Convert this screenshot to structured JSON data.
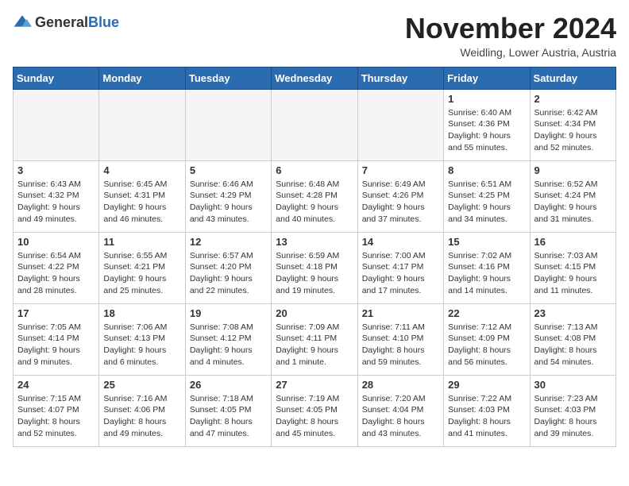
{
  "header": {
    "logo_general": "General",
    "logo_blue": "Blue",
    "month_title": "November 2024",
    "location": "Weidling, Lower Austria, Austria"
  },
  "weekdays": [
    "Sunday",
    "Monday",
    "Tuesday",
    "Wednesday",
    "Thursday",
    "Friday",
    "Saturday"
  ],
  "weeks": [
    [
      {
        "day": "",
        "info": ""
      },
      {
        "day": "",
        "info": ""
      },
      {
        "day": "",
        "info": ""
      },
      {
        "day": "",
        "info": ""
      },
      {
        "day": "",
        "info": ""
      },
      {
        "day": "1",
        "info": "Sunrise: 6:40 AM\nSunset: 4:36 PM\nDaylight: 9 hours\nand 55 minutes."
      },
      {
        "day": "2",
        "info": "Sunrise: 6:42 AM\nSunset: 4:34 PM\nDaylight: 9 hours\nand 52 minutes."
      }
    ],
    [
      {
        "day": "3",
        "info": "Sunrise: 6:43 AM\nSunset: 4:32 PM\nDaylight: 9 hours\nand 49 minutes."
      },
      {
        "day": "4",
        "info": "Sunrise: 6:45 AM\nSunset: 4:31 PM\nDaylight: 9 hours\nand 46 minutes."
      },
      {
        "day": "5",
        "info": "Sunrise: 6:46 AM\nSunset: 4:29 PM\nDaylight: 9 hours\nand 43 minutes."
      },
      {
        "day": "6",
        "info": "Sunrise: 6:48 AM\nSunset: 4:28 PM\nDaylight: 9 hours\nand 40 minutes."
      },
      {
        "day": "7",
        "info": "Sunrise: 6:49 AM\nSunset: 4:26 PM\nDaylight: 9 hours\nand 37 minutes."
      },
      {
        "day": "8",
        "info": "Sunrise: 6:51 AM\nSunset: 4:25 PM\nDaylight: 9 hours\nand 34 minutes."
      },
      {
        "day": "9",
        "info": "Sunrise: 6:52 AM\nSunset: 4:24 PM\nDaylight: 9 hours\nand 31 minutes."
      }
    ],
    [
      {
        "day": "10",
        "info": "Sunrise: 6:54 AM\nSunset: 4:22 PM\nDaylight: 9 hours\nand 28 minutes."
      },
      {
        "day": "11",
        "info": "Sunrise: 6:55 AM\nSunset: 4:21 PM\nDaylight: 9 hours\nand 25 minutes."
      },
      {
        "day": "12",
        "info": "Sunrise: 6:57 AM\nSunset: 4:20 PM\nDaylight: 9 hours\nand 22 minutes."
      },
      {
        "day": "13",
        "info": "Sunrise: 6:59 AM\nSunset: 4:18 PM\nDaylight: 9 hours\nand 19 minutes."
      },
      {
        "day": "14",
        "info": "Sunrise: 7:00 AM\nSunset: 4:17 PM\nDaylight: 9 hours\nand 17 minutes."
      },
      {
        "day": "15",
        "info": "Sunrise: 7:02 AM\nSunset: 4:16 PM\nDaylight: 9 hours\nand 14 minutes."
      },
      {
        "day": "16",
        "info": "Sunrise: 7:03 AM\nSunset: 4:15 PM\nDaylight: 9 hours\nand 11 minutes."
      }
    ],
    [
      {
        "day": "17",
        "info": "Sunrise: 7:05 AM\nSunset: 4:14 PM\nDaylight: 9 hours\nand 9 minutes."
      },
      {
        "day": "18",
        "info": "Sunrise: 7:06 AM\nSunset: 4:13 PM\nDaylight: 9 hours\nand 6 minutes."
      },
      {
        "day": "19",
        "info": "Sunrise: 7:08 AM\nSunset: 4:12 PM\nDaylight: 9 hours\nand 4 minutes."
      },
      {
        "day": "20",
        "info": "Sunrise: 7:09 AM\nSunset: 4:11 PM\nDaylight: 9 hours\nand 1 minute."
      },
      {
        "day": "21",
        "info": "Sunrise: 7:11 AM\nSunset: 4:10 PM\nDaylight: 8 hours\nand 59 minutes."
      },
      {
        "day": "22",
        "info": "Sunrise: 7:12 AM\nSunset: 4:09 PM\nDaylight: 8 hours\nand 56 minutes."
      },
      {
        "day": "23",
        "info": "Sunrise: 7:13 AM\nSunset: 4:08 PM\nDaylight: 8 hours\nand 54 minutes."
      }
    ],
    [
      {
        "day": "24",
        "info": "Sunrise: 7:15 AM\nSunset: 4:07 PM\nDaylight: 8 hours\nand 52 minutes."
      },
      {
        "day": "25",
        "info": "Sunrise: 7:16 AM\nSunset: 4:06 PM\nDaylight: 8 hours\nand 49 minutes."
      },
      {
        "day": "26",
        "info": "Sunrise: 7:18 AM\nSunset: 4:05 PM\nDaylight: 8 hours\nand 47 minutes."
      },
      {
        "day": "27",
        "info": "Sunrise: 7:19 AM\nSunset: 4:05 PM\nDaylight: 8 hours\nand 45 minutes."
      },
      {
        "day": "28",
        "info": "Sunrise: 7:20 AM\nSunset: 4:04 PM\nDaylight: 8 hours\nand 43 minutes."
      },
      {
        "day": "29",
        "info": "Sunrise: 7:22 AM\nSunset: 4:03 PM\nDaylight: 8 hours\nand 41 minutes."
      },
      {
        "day": "30",
        "info": "Sunrise: 7:23 AM\nSunset: 4:03 PM\nDaylight: 8 hours\nand 39 minutes."
      }
    ]
  ]
}
